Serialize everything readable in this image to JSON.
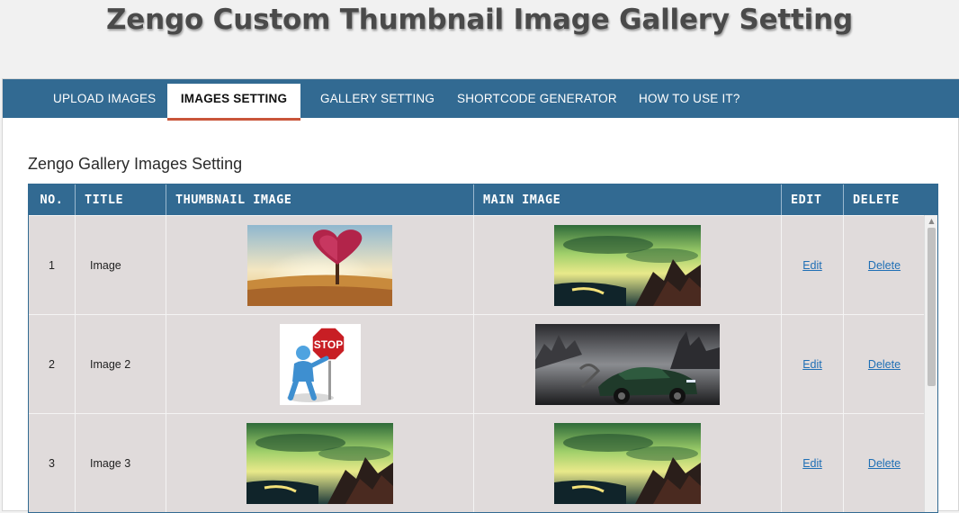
{
  "header": {
    "title": "Zengo Custom Thumbnail Image Gallery Setting"
  },
  "tabs": [
    {
      "label": "UPLOAD IMAGES",
      "active": false
    },
    {
      "label": "IMAGES SETTING",
      "active": true
    },
    {
      "label": "GALLERY SETTING",
      "active": false
    },
    {
      "label": "SHORTCODE GENERATOR",
      "active": false
    },
    {
      "label": "HOW TO USE IT?",
      "active": false
    }
  ],
  "section": {
    "title": "Zengo Gallery Images Setting"
  },
  "table": {
    "columns": [
      "NO.",
      "TITLE",
      "THUMBNAIL IMAGE",
      "MAIN IMAGE",
      "EDIT",
      "DELETE"
    ],
    "rows": [
      {
        "no": "1",
        "title": "Image",
        "thumbnail": "heart-tree-image",
        "main": "green-sky-landscape-image",
        "edit": "Edit",
        "delete": "Delete"
      },
      {
        "no": "2",
        "title": "Image 2",
        "thumbnail": "stop-sign-figure-image",
        "main": "dark-car-image",
        "edit": "Edit",
        "delete": "Delete"
      },
      {
        "no": "3",
        "title": "Image 3",
        "thumbnail": "green-sky-landscape-image",
        "main": "green-sky-landscape-image",
        "edit": "Edit",
        "delete": "Delete"
      }
    ]
  },
  "colors": {
    "accent": "#326a92",
    "tab_underline": "#c9553a",
    "link": "#1f6fb5",
    "row_bg": "#e0dbdb"
  }
}
